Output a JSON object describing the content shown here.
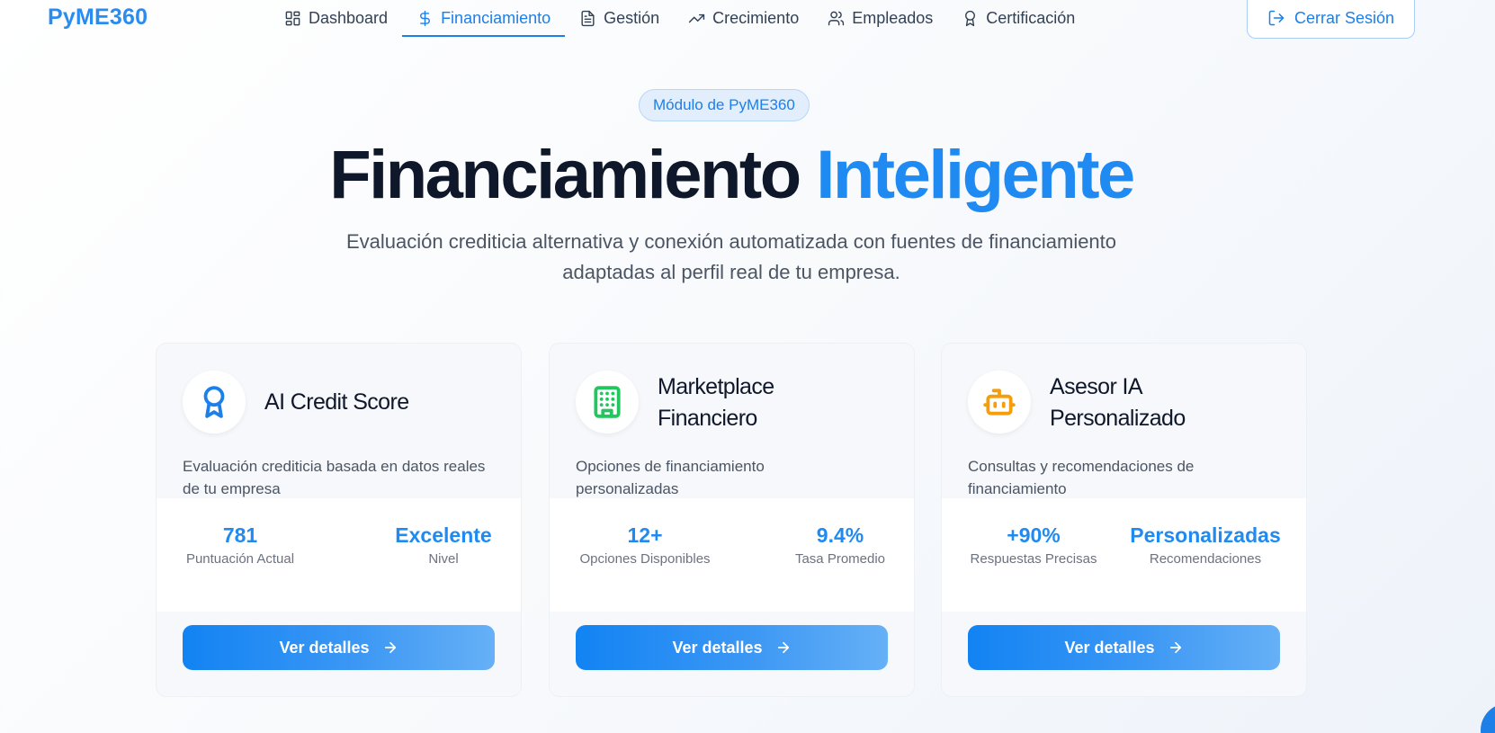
{
  "nav": {
    "brand": "PyME360",
    "items": [
      {
        "label": "Dashboard",
        "icon": "grid-icon",
        "active": false
      },
      {
        "label": "Financiamiento",
        "icon": "dollar-icon",
        "active": true
      },
      {
        "label": "Gestión",
        "icon": "document-icon",
        "active": false
      },
      {
        "label": "Crecimiento",
        "icon": "trend-up-icon",
        "active": false
      },
      {
        "label": "Empleados",
        "icon": "users-icon",
        "active": false
      },
      {
        "label": "Certificación",
        "icon": "award-icon",
        "active": false
      }
    ],
    "logout_label": "Cerrar Sesión"
  },
  "hero": {
    "badge": "Módulo de PyME360",
    "title_main": "Financiamiento",
    "title_accent": "Inteligente",
    "subtitle_line1": "Evaluación crediticia alternativa y conexión automatizada con fuentes de financiamiento",
    "subtitle_line2": "adaptadas al perfil real de tu empresa."
  },
  "cards": [
    {
      "title": "AI Credit Score",
      "icon": "award-icon",
      "icon_color": "#1d7fe8",
      "description": "Evaluación crediticia basada en datos reales de tu empresa",
      "stat1": {
        "value": "781",
        "label": "Puntuación Actual"
      },
      "stat2": {
        "value": "Excelente",
        "label": "Nivel"
      },
      "button": "Ver detalles"
    },
    {
      "title_line1": "Marketplace",
      "title_line2": "Financiero",
      "icon": "building-icon",
      "icon_color": "#22c55e",
      "description": "Opciones de financiamiento personalizadas",
      "stat1": {
        "value": "12+",
        "label": "Opciones Disponibles"
      },
      "stat2": {
        "value": "9.4%",
        "label": "Tasa Promedio"
      },
      "button": "Ver detalles"
    },
    {
      "title_line1": "Asesor IA",
      "title_line2": "Personalizado",
      "icon": "bot-icon",
      "icon_color": "#f59e0b",
      "description": "Consultas y recomendaciones de financiamiento",
      "stat1": {
        "value": "+90%",
        "label": "Respuestas Precisas"
      },
      "stat2": {
        "value": "Personalizadas",
        "label": "Recomendaciones"
      },
      "button": "Ver detalles"
    }
  ],
  "colors": {
    "accent": "#1f8bf2",
    "heading": "#0f172a",
    "muted": "#6b7280"
  }
}
